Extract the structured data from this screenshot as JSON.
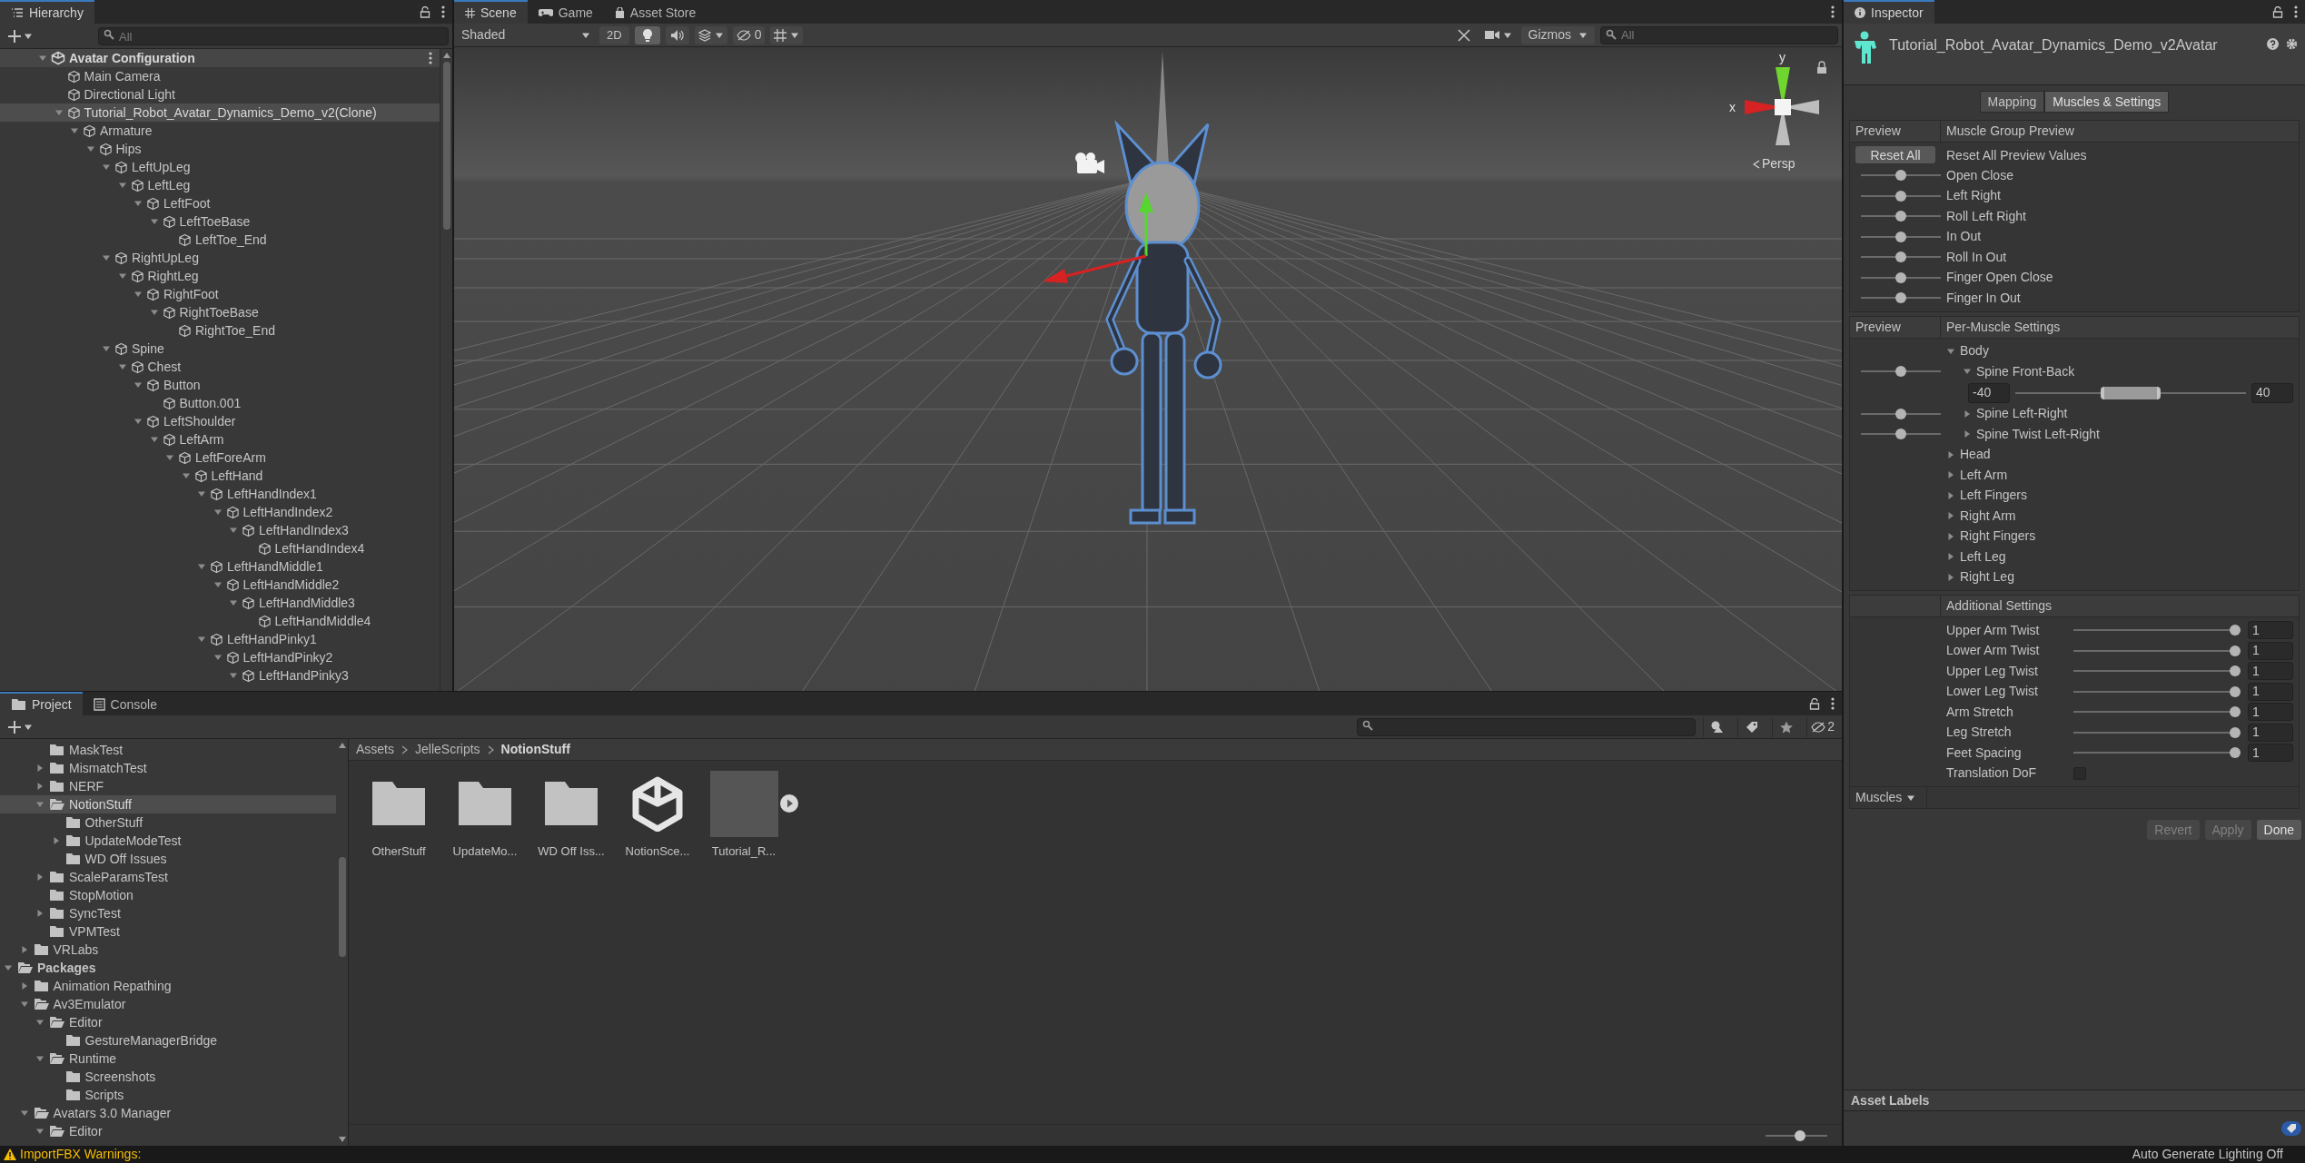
{
  "hierarchy": {
    "title": "Hierarchy",
    "search": {
      "placeholder": "All"
    },
    "tree": [
      {
        "label": "Avatar Configuration",
        "kind": "scene",
        "expanded": true,
        "selected": false,
        "children": [
          {
            "label": "Main Camera",
            "selected": false
          },
          {
            "label": "Directional Light",
            "selected": false
          },
          {
            "label": "Tutorial_Robot_Avatar_Dynamics_Demo_v2(Clone)",
            "expanded": true,
            "selected": true,
            "children": [
              {
                "label": "Armature",
                "expanded": true,
                "selected": false,
                "children": [
                  {
                    "label": "Hips",
                    "expanded": true,
                    "selected": false,
                    "children": [
                      {
                        "label": "LeftUpLeg",
                        "expanded": true,
                        "selected": false,
                        "children": [
                          {
                            "label": "LeftLeg",
                            "expanded": true,
                            "selected": false,
                            "children": [
                              {
                                "label": "LeftFoot",
                                "expanded": true,
                                "selected": false,
                                "children": [
                                  {
                                    "label": "LeftToeBase",
                                    "expanded": true,
                                    "selected": false,
                                    "children": [
                                      {
                                        "label": "LeftToe_End",
                                        "selected": false
                                      }
                                    ]
                                  }
                                ]
                              }
                            ]
                          }
                        ]
                      },
                      {
                        "label": "RightUpLeg",
                        "expanded": true,
                        "selected": false,
                        "children": [
                          {
                            "label": "RightLeg",
                            "expanded": true,
                            "selected": false,
                            "children": [
                              {
                                "label": "RightFoot",
                                "expanded": true,
                                "selected": false,
                                "children": [
                                  {
                                    "label": "RightToeBase",
                                    "expanded": true,
                                    "selected": false,
                                    "children": [
                                      {
                                        "label": "RightToe_End",
                                        "selected": false
                                      }
                                    ]
                                  }
                                ]
                              }
                            ]
                          }
                        ]
                      },
                      {
                        "label": "Spine",
                        "expanded": true,
                        "selected": false,
                        "children": [
                          {
                            "label": "Chest",
                            "expanded": true,
                            "selected": false,
                            "children": [
                              {
                                "label": "Button",
                                "expanded": true,
                                "selected": false,
                                "children": [
                                  {
                                    "label": "Button.001",
                                    "selected": false
                                  }
                                ]
                              },
                              {
                                "label": "LeftShoulder",
                                "expanded": true,
                                "selected": false,
                                "children": [
                                  {
                                    "label": "LeftArm",
                                    "expanded": true,
                                    "selected": false,
                                    "children": [
                                      {
                                        "label": "LeftForeArm",
                                        "expanded": true,
                                        "selected": false,
                                        "children": [
                                          {
                                            "label": "LeftHand",
                                            "expanded": true,
                                            "selected": false,
                                            "children": [
                                              {
                                                "label": "LeftHandIndex1",
                                                "expanded": true,
                                                "selected": false,
                                                "children": [
                                                  {
                                                    "label": "LeftHandIndex2",
                                                    "expanded": true,
                                                    "selected": false,
                                                    "children": [
                                                      {
                                                        "label": "LeftHandIndex3",
                                                        "expanded": true,
                                                        "selected": false,
                                                        "children": [
                                                          {
                                                            "label": "LeftHandIndex4",
                                                            "selected": false
                                                          }
                                                        ]
                                                      }
                                                    ]
                                                  }
                                                ]
                                              },
                                              {
                                                "label": "LeftHandMiddle1",
                                                "expanded": true,
                                                "selected": false,
                                                "children": [
                                                  {
                                                    "label": "LeftHandMiddle2",
                                                    "expanded": true,
                                                    "selected": false,
                                                    "children": [
                                                      {
                                                        "label": "LeftHandMiddle3",
                                                        "expanded": true,
                                                        "selected": false,
                                                        "children": [
                                                          {
                                                            "label": "LeftHandMiddle4",
                                                            "selected": false
                                                          }
                                                        ]
                                                      }
                                                    ]
                                                  }
                                                ]
                                              },
                                              {
                                                "label": "LeftHandPinky1",
                                                "expanded": true,
                                                "selected": false,
                                                "children": [
                                                  {
                                                    "label": "LeftHandPinky2",
                                                    "expanded": true,
                                                    "selected": false,
                                                    "children": [
                                                      {
                                                        "label": "LeftHandPinky3",
                                                        "expanded": true,
                                                        "selected": false
                                                      }
                                                    ]
                                                  }
                                                ]
                                              }
                                            ]
                                          }
                                        ]
                                      }
                                    ]
                                  }
                                ]
                              }
                            ]
                          }
                        ]
                      }
                    ]
                  }
                ]
              }
            ]
          }
        ]
      }
    ]
  },
  "scene": {
    "tabs": [
      {
        "label": "Scene",
        "kind": "scene",
        "selected": true
      },
      {
        "label": "Game",
        "kind": "game",
        "selected": false
      },
      {
        "label": "Asset Store",
        "kind": "store",
        "selected": false
      }
    ],
    "toolbar": {
      "shading": "Shaded",
      "toggle_2d": {
        "label": "2D",
        "on": false
      },
      "lighting_on": true,
      "hidden_count": "0",
      "gizmos": "Gizmos",
      "search": {
        "placeholder": "All"
      }
    },
    "gizmo": {
      "y_label": "y",
      "x_label": "x",
      "projection": "Persp"
    }
  },
  "inspector": {
    "title": "Inspector",
    "object_name": "Tutorial_Robot_Avatar_Dynamics_Demo_v2Avatar",
    "tabs": [
      {
        "label": "Mapping",
        "selected": false
      },
      {
        "label": "Muscles & Settings",
        "selected": true
      }
    ],
    "muscle_group": {
      "column_1": "Preview",
      "column_2": "Muscle Group Preview",
      "reset_button": "Reset All",
      "reset_label": "Reset All Preview Values",
      "sliders": [
        {
          "label": "Open Close",
          "level": 0.5
        },
        {
          "label": "Left Right",
          "level": 0.5
        },
        {
          "label": "Roll Left Right",
          "level": 0.5
        },
        {
          "label": "In Out",
          "level": 0.5
        },
        {
          "label": "Roll In Out",
          "level": 0.5
        },
        {
          "label": "Finger Open Close",
          "level": 0.5
        },
        {
          "label": "Finger In Out",
          "level": 0.5
        }
      ]
    },
    "per_muscle": {
      "column_1": "Preview",
      "column_2": "Per-Muscle Settings",
      "tree": [
        {
          "label": "Body",
          "expanded": true,
          "children": [
            {
              "label": "Spine Front-Back",
              "expanded": true,
              "level": 0.5,
              "range": {
                "min": "-40",
                "max": "40",
                "level": 0.5
              }
            },
            {
              "label": "Spine Left-Right",
              "expanded": false,
              "level": 0.5
            },
            {
              "label": "Spine Twist Left-Right",
              "expanded": false,
              "level": 0.5
            }
          ]
        },
        {
          "label": "Head",
          "expanded": false
        },
        {
          "label": "Left Arm",
          "expanded": false
        },
        {
          "label": "Left Fingers",
          "expanded": false
        },
        {
          "label": "Right Arm",
          "expanded": false
        },
        {
          "label": "Right Fingers",
          "expanded": false
        },
        {
          "label": "Left Leg",
          "expanded": false
        },
        {
          "label": "Right Leg",
          "expanded": false
        }
      ]
    },
    "additional": {
      "header": "Additional Settings",
      "rows": [
        {
          "kind": "slider",
          "label": "Upper Arm Twist",
          "level": 1,
          "value": "1"
        },
        {
          "kind": "slider",
          "label": "Lower Arm Twist",
          "level": 1,
          "value": "1"
        },
        {
          "kind": "slider",
          "label": "Upper Leg Twist",
          "level": 1,
          "value": "1"
        },
        {
          "kind": "slider",
          "label": "Lower Leg Twist",
          "level": 1,
          "value": "1"
        },
        {
          "kind": "slider",
          "label": "Arm Stretch",
          "level": 1,
          "value": "1"
        },
        {
          "kind": "slider",
          "label": "Leg Stretch",
          "level": 1,
          "value": "1"
        },
        {
          "kind": "slider",
          "label": "Feet Spacing",
          "level": 1,
          "value": "1"
        },
        {
          "kind": "checkbox",
          "label": "Translation DoF",
          "checked": false
        }
      ]
    },
    "view_dropdown": "Muscles",
    "buttons": [
      {
        "label": "Revert",
        "disabled": true
      },
      {
        "label": "Apply",
        "disabled": true
      },
      {
        "label": "Done",
        "disabled": false
      }
    ],
    "asset_labels": "Asset Labels"
  },
  "project": {
    "tabs": [
      {
        "label": "Project",
        "kind": "project",
        "selected": true
      },
      {
        "label": "Console",
        "kind": "console",
        "selected": false
      }
    ],
    "hidden_count": "2",
    "folders": [
      {
        "children": [
          {
            "children": [
              {
                "label": "MaskTest",
                "selected": false
              },
              {
                "label": "MismatchTest",
                "expanded": false,
                "selected": false
              },
              {
                "label": "NERF",
                "expanded": false,
                "selected": false
              },
              {
                "label": "NotionStuff",
                "expanded": true,
                "selected": true,
                "children": [
                  {
                    "label": "OtherStuff",
                    "selected": false
                  },
                  {
                    "label": "UpdateModeTest",
                    "expanded": false,
                    "selected": false
                  },
                  {
                    "label": "WD Off Issues",
                    "selected": false
                  }
                ]
              },
              {
                "label": "ScaleParamsTest",
                "expanded": false,
                "selected": false
              },
              {
                "label": "StopMotion",
                "selected": false
              },
              {
                "label": "SyncTest",
                "expanded": false,
                "selected": false
              },
              {
                "label": "VPMTest",
                "selected": false
              }
            ]
          },
          {
            "label": "VRLabs",
            "expanded": false,
            "selected": false
          }
        ]
      },
      {
        "label": "Packages",
        "expanded": true,
        "selected": false,
        "children": [
          {
            "label": "Animation Repathing",
            "expanded": false,
            "selected": false
          },
          {
            "label": "Av3Emulator",
            "expanded": true,
            "selected": false,
            "children": [
              {
                "label": "Editor",
                "expanded": true,
                "selected": false,
                "children": [
                  {
                    "label": "GestureManagerBridge",
                    "selected": false
                  }
                ]
              },
              {
                "label": "Runtime",
                "expanded": true,
                "selected": false,
                "children": [
                  {
                    "label": "Screenshots",
                    "selected": false
                  },
                  {
                    "label": "Scripts",
                    "selected": false
                  }
                ]
              }
            ]
          },
          {
            "label": "Avatars 3.0 Manager",
            "expanded": true,
            "selected": false,
            "children": [
              {
                "label": "Editor",
                "expanded": true,
                "selected": false
              }
            ]
          }
        ]
      }
    ],
    "breadcrumb": [
      "Assets",
      "JelleScripts",
      "NotionStuff"
    ],
    "assets": [
      {
        "kind": "folder",
        "label": "OtherStuff"
      },
      {
        "kind": "folder",
        "label": "UpdateMo..."
      },
      {
        "kind": "folder",
        "label": "WD Off Iss..."
      },
      {
        "kind": "scene",
        "label": "NotionSce..."
      },
      {
        "kind": "model",
        "label": "Tutorial_R..."
      }
    ],
    "zoom": {
      "level": 0.58
    }
  },
  "status_bar": {
    "warning": "ImportFBX Warnings:",
    "lighting": "Auto Generate Lighting Off"
  }
}
